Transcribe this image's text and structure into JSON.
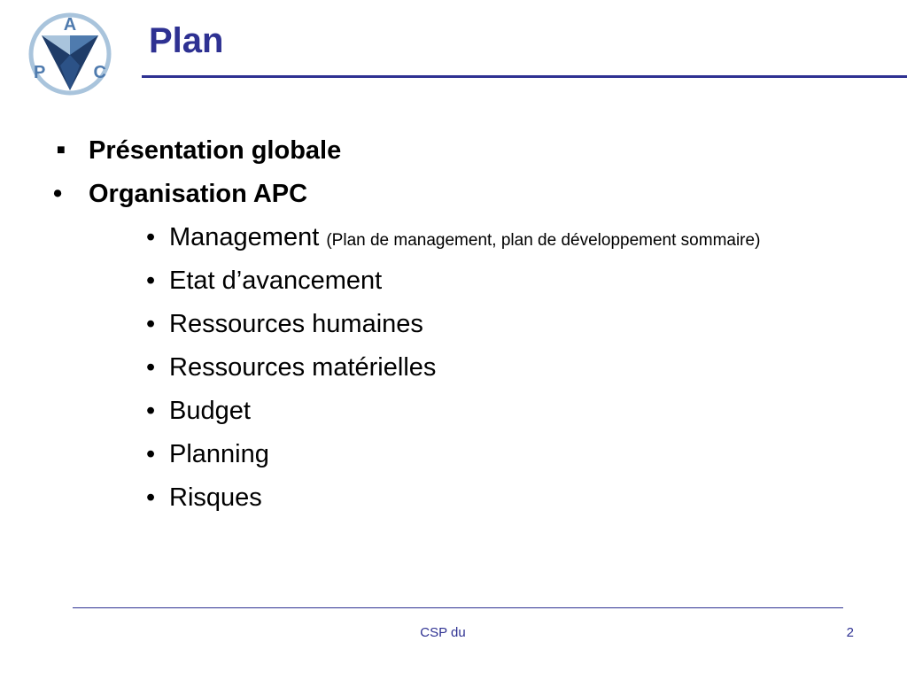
{
  "logo": {
    "letters": [
      "A",
      "P",
      "C"
    ],
    "colors": {
      "dark": "#1F3C68",
      "light": "#A9C4DC",
      "mid": "#4F7BAE"
    }
  },
  "slide": {
    "title": "Plan",
    "bullets_level1": [
      {
        "marker": "square",
        "text": "Présentation globale"
      },
      {
        "marker": "dot",
        "text": "Organisation APC"
      }
    ],
    "bullets_level2": [
      {
        "text": "Management",
        "note": "(Plan de management, plan de développement sommaire)"
      },
      {
        "text": "Etat d’avancement"
      },
      {
        "text": "Ressources humaines"
      },
      {
        "text": "Ressources matérielles"
      },
      {
        "text": "Budget"
      },
      {
        "text": "Planning"
      },
      {
        "text": "Risques"
      }
    ]
  },
  "footer": {
    "center_text": "CSP du",
    "page_number": "2"
  },
  "colors": {
    "accent": "#2E3192",
    "text": "#000000",
    "background": "#FFFFFF"
  }
}
